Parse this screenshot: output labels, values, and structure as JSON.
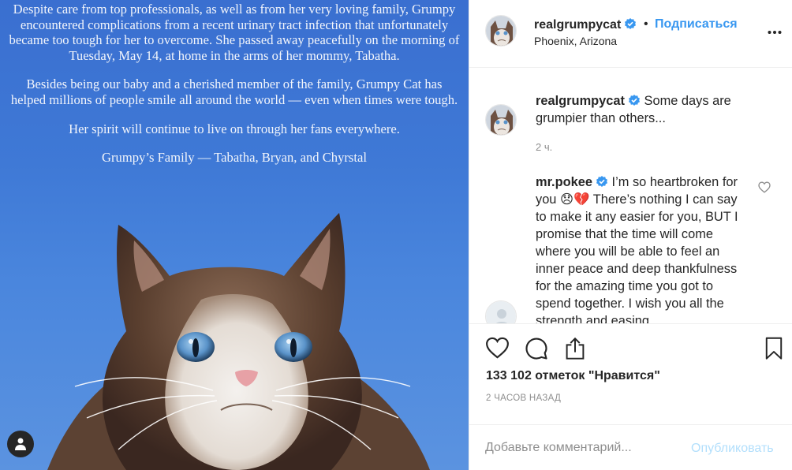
{
  "post_image": {
    "paragraphs": [
      "Despite care from top professionals, as well as from her very loving family, Grumpy encountered complications from a recent urinary tract infection that unfortunately became too tough for her to overcome.  She passed away peacefully on the morning of Tuesday, May 14, at home in the arms of her mommy, Tabatha.",
      "Besides being our baby and a cherished member of the family, Grumpy Cat has helped millions of people smile all around the world — even when times were tough.",
      "Her spirit will continue to live on through her fans everywhere.",
      "Grumpy’s Family — Tabatha, Bryan, and Chyrstal"
    ],
    "background_color": "#3f79d6"
  },
  "header": {
    "username": "realgrumpycat",
    "separator": "•",
    "follow_label": "Подписаться",
    "location": "Phoenix, Arizona",
    "verified_icon": "verified-badge-icon",
    "more_icon": "more-options-icon"
  },
  "comments": [
    {
      "username": "realgrumpycat",
      "text": "Some days are grumpier than others...",
      "time": "2 ч."
    },
    {
      "username": "mr.pokee",
      "text": "I’m so heartbroken for you 😞💔 There’s nothing I can say to make it any easier for you, BUT I promise that the time will come where you will be able to feel an inner peace and deep thankfulness for the amazing time you got to spend together. I wish you all the strength and easing"
    }
  ],
  "actions": {
    "like_icon": "heart-icon",
    "comment_icon": "comment-icon",
    "share_icon": "share-icon",
    "save_icon": "bookmark-icon"
  },
  "likes": "133 102 отметок \"Нравится\"",
  "time_ago": "2 ЧАСОВ НАЗАД",
  "comment_form": {
    "placeholder": "Добавьте комментарий...",
    "publish_label": "Опубликовать"
  },
  "colors": {
    "accent": "#3897f0",
    "publish_disabled": "#b2dffc",
    "muted": "#8e8e8e"
  }
}
